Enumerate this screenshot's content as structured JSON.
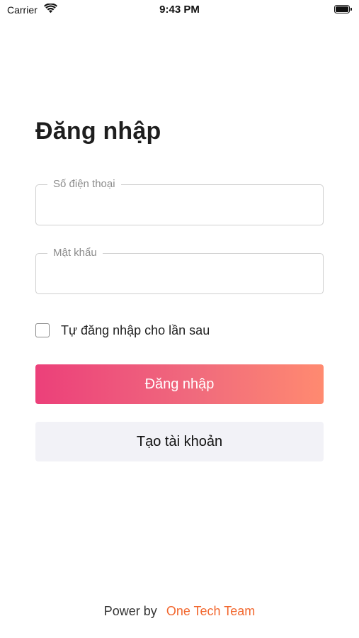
{
  "status_bar": {
    "carrier": "Carrier",
    "time": "9:43 PM",
    "wifi_icon": "wifi-icon",
    "battery_icon": "battery-icon"
  },
  "login": {
    "title": "Đăng nhập",
    "phone_label": "Số điện thoại",
    "phone_value": "",
    "password_label": "Mật khẩu",
    "password_value": "",
    "remember_label": "Tự đăng nhập cho lần sau",
    "remember_checked": false,
    "login_button": "Đăng nhập",
    "register_button": "Tạo tài khoản"
  },
  "footer": {
    "prefix": "Power by",
    "brand": "One Tech Team"
  },
  "colors": {
    "gradient_start": "#ec407a",
    "gradient_end": "#ff8a70",
    "secondary_button_bg": "#f2f2f7",
    "brand_text": "#f2672e"
  }
}
